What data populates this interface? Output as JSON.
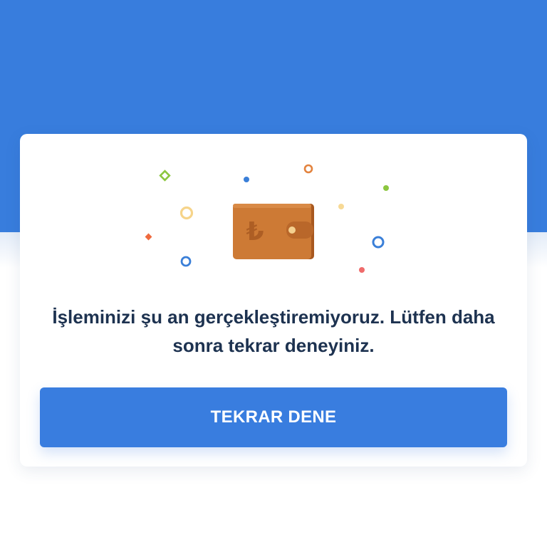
{
  "header": {
    "background_color": "#387ddd"
  },
  "card": {
    "illustration": {
      "icon": "wallet-lira-icon",
      "currency_symbol": "₺",
      "wallet_color": "#cd7a35",
      "confetti": [
        "green-diamond",
        "blue-dot",
        "orange-ring",
        "green-dot",
        "yellow-ring",
        "yellow-dot",
        "orange-diamond",
        "blue-ring",
        "blue-ring",
        "red-dot"
      ]
    },
    "message": "İşleminizi şu an gerçekleştiremiyoruz. Lütfen daha sonra tekrar deneyiniz.",
    "retry_label": "TEKRAR DENE",
    "button_color": "#397ddf"
  }
}
